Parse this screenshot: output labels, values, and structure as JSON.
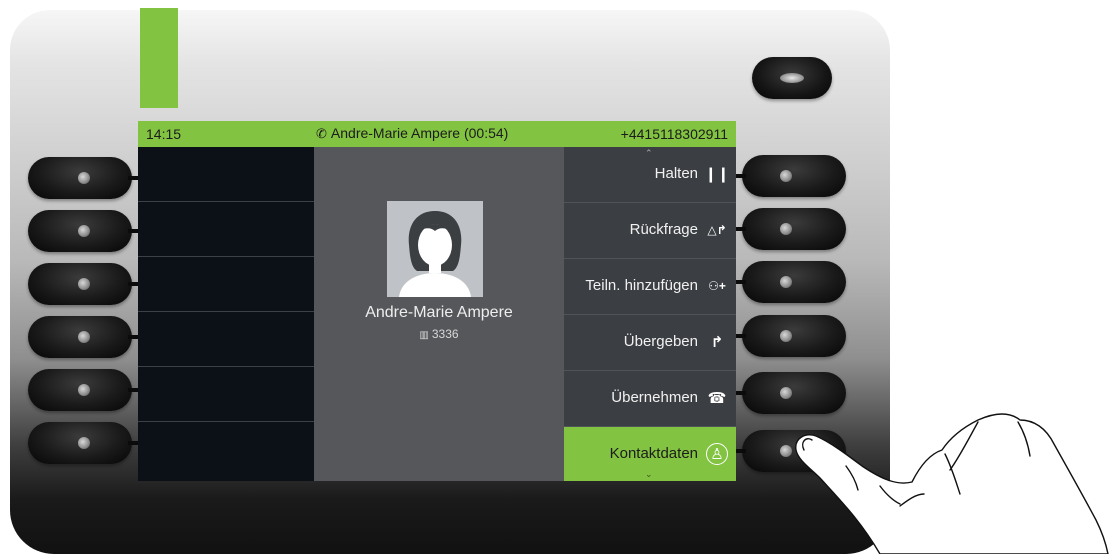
{
  "status_bar": {
    "time": "14:15",
    "call_label": "Andre-Marie Ampere (00:54)",
    "number": "+4415118302911",
    "call_icon": "phone-handset-icon"
  },
  "contact": {
    "name": "Andre-Marie Ampere",
    "extension": "3336",
    "extension_icon": "building-icon",
    "avatar_icon": "person-silhouette-icon"
  },
  "menu": {
    "items": [
      {
        "label": "Halten",
        "icon": "pause-icon",
        "glyph": "❙❙"
      },
      {
        "label": "Rückfrage",
        "icon": "consult-icon",
        "glyph": "△↱"
      },
      {
        "label": "Teiln. hinzufügen",
        "icon": "add-participant-icon",
        "glyph": "⚇+"
      },
      {
        "label": "Übergeben",
        "icon": "transfer-icon",
        "glyph": "↱"
      },
      {
        "label": "Übernehmen",
        "icon": "pickup-icon",
        "glyph": "☎"
      },
      {
        "label": "Kontaktdaten",
        "icon": "contact-icon",
        "glyph": "♙",
        "selected": true
      }
    ]
  },
  "colors": {
    "accent": "#82c341",
    "menu_bg": "#3b3e42",
    "center_bg": "#55575a"
  }
}
